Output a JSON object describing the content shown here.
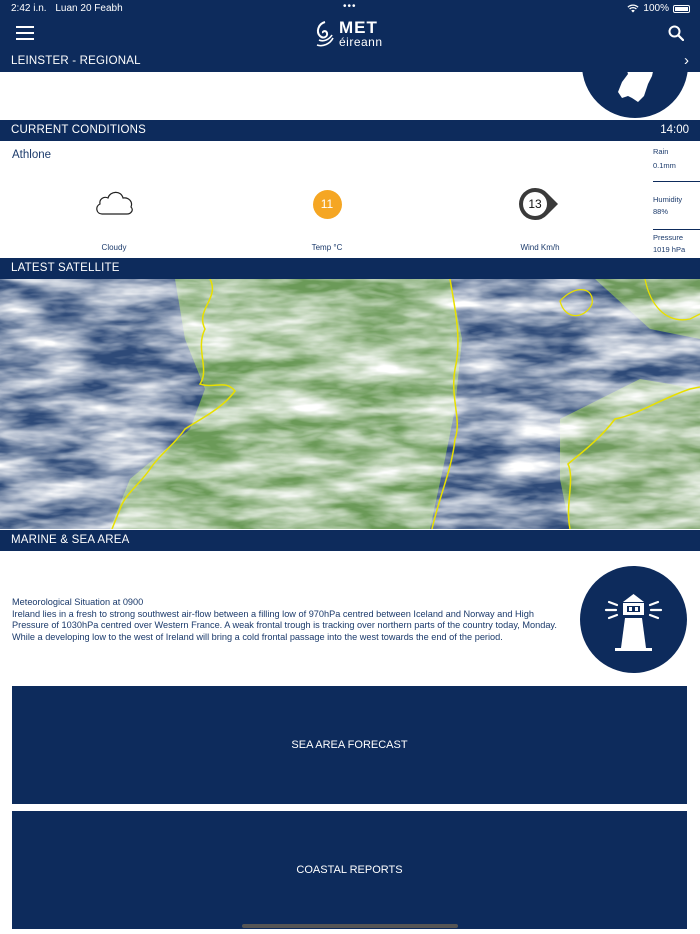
{
  "status_bar": {
    "time": "2:42 i.n.",
    "date": "Luan 20 Feabh",
    "battery": "100%"
  },
  "header": {
    "logo_line1": "MET",
    "logo_line2": "éireann"
  },
  "regional": {
    "title": "LEINSTER - REGIONAL",
    "chevron": "›"
  },
  "current_conditions": {
    "title": "CURRENT CONDITIONS",
    "time": "14:00",
    "location": "Athlone",
    "weather_label": "Cloudy",
    "temp_value": "11",
    "temp_label": "Temp °C",
    "wind_value": "13",
    "wind_label": "Wind Km/h",
    "rain_label": "Rain",
    "rain_value": "0.1mm",
    "humidity_label": "Humidity",
    "humidity_value": "88%",
    "pressure_label": "Pressure",
    "pressure_value": "1019 hPa"
  },
  "satellite": {
    "title": "LATEST SATELLITE"
  },
  "marine": {
    "title": "MARINE & SEA AREA",
    "situation_heading": "Meteorological Situation at 0900",
    "situation_text": "Ireland lies in a fresh to strong southwest air-flow between a filling low of 970hPa centred between Iceland and Norway and High Pressure of 1030hPa centred over Western France. A weak frontal trough is tracking over northern parts of the country today, Monday. While a developing low to the west of Ireland will bring a cold frontal passage into the west towards the end of the period.",
    "sea_area_button": "SEA AREA FORECAST",
    "coastal_button": "COASTAL REPORTS"
  },
  "colors": {
    "brand_navy": "#0d2b5c",
    "temp_orange": "#f5a623",
    "coast_yellow": "#e8e000"
  }
}
